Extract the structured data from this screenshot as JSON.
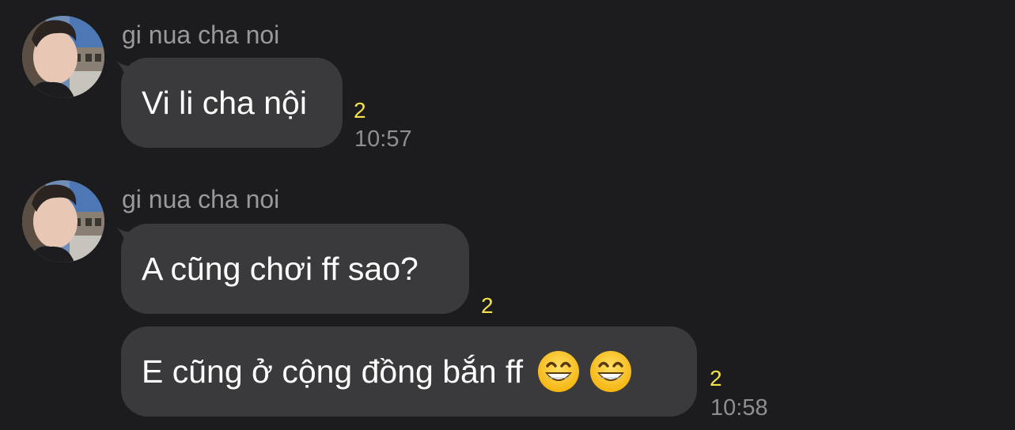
{
  "messages": [
    {
      "sender": "gi nua cha noi",
      "bubbles": [
        {
          "text": "Vi li cha nội",
          "reaction_count": "2",
          "time": "10:57"
        }
      ]
    },
    {
      "sender": "gi nua cha noi",
      "bubbles": [
        {
          "text": "A cũng chơi ff sao?",
          "reaction_count": "2",
          "time": ""
        },
        {
          "text": "E cũng ở cộng đồng bắn ff",
          "emojis": [
            "grinning-face-emoji",
            "grinning-face-emoji"
          ],
          "reaction_count": "2",
          "time": "10:58"
        }
      ]
    }
  ],
  "colors": {
    "background": "#1c1c1e",
    "bubble": "#3a3a3c",
    "sender_text": "#98989d",
    "reaction": "#f2e14b",
    "timestamp": "#8e8e93"
  }
}
